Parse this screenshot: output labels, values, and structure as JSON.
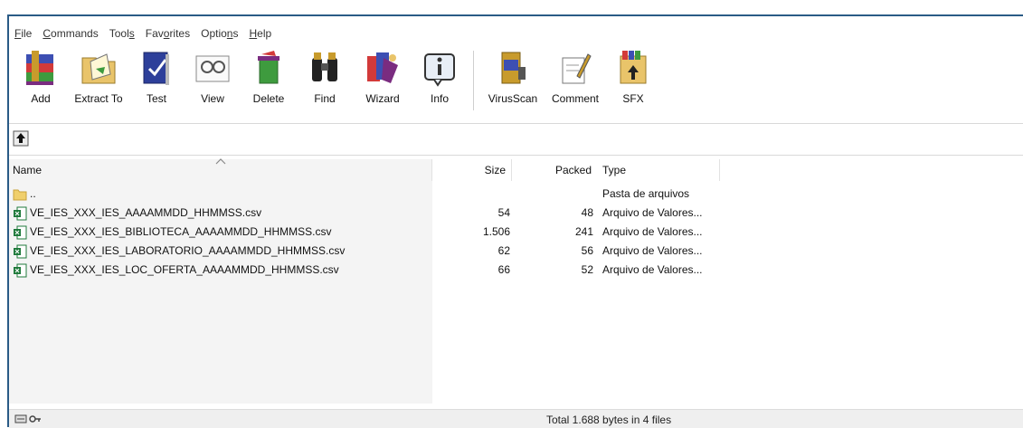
{
  "menu": [
    {
      "pre": "",
      "acc": "F",
      "post": "ile"
    },
    {
      "pre": "",
      "acc": "C",
      "post": "ommands"
    },
    {
      "pre": "Tool",
      "acc": "s",
      "post": ""
    },
    {
      "pre": "Fav",
      "acc": "o",
      "post": "rites"
    },
    {
      "pre": "Optio",
      "acc": "n",
      "post": "s"
    },
    {
      "pre": "",
      "acc": "H",
      "post": "elp"
    }
  ],
  "toolbar": {
    "add": "Add",
    "extract": "Extract To",
    "test": "Test",
    "view": "View",
    "delete": "Delete",
    "find": "Find",
    "wizard": "Wizard",
    "info": "Info",
    "virusscan": "VirusScan",
    "comment": "Comment",
    "sfx": "SFX"
  },
  "columns": {
    "name": "Name",
    "size": "Size",
    "packed": "Packed",
    "type": "Type"
  },
  "rows": [
    {
      "name": "..",
      "size": "",
      "packed": "",
      "type": "Pasta de arquivos",
      "icon": "folder-icon"
    },
    {
      "name": "VE_IES_XXX_IES_AAAAMMDD_HHMMSS.csv",
      "size": "54",
      "packed": "48",
      "type": "Arquivo de Valores...",
      "icon": "csv-file-icon"
    },
    {
      "name": "VE_IES_XXX_IES_BIBLIOTECA_AAAAMMDD_HHMMSS.csv",
      "size": "1.506",
      "packed": "241",
      "type": "Arquivo de Valores...",
      "icon": "csv-file-icon"
    },
    {
      "name": "VE_IES_XXX_IES_LABORATORIO_AAAAMMDD_HHMMSS.csv",
      "size": "62",
      "packed": "56",
      "type": "Arquivo de Valores...",
      "icon": "csv-file-icon"
    },
    {
      "name": "VE_IES_XXX_IES_LOC_OFERTA_AAAAMMDD_HHMMSS.csv",
      "size": "66",
      "packed": "52",
      "type": "Arquivo de Valores...",
      "icon": "csv-file-icon"
    }
  ],
  "status": {
    "text": "Total 1.688 bytes in 4 files"
  }
}
